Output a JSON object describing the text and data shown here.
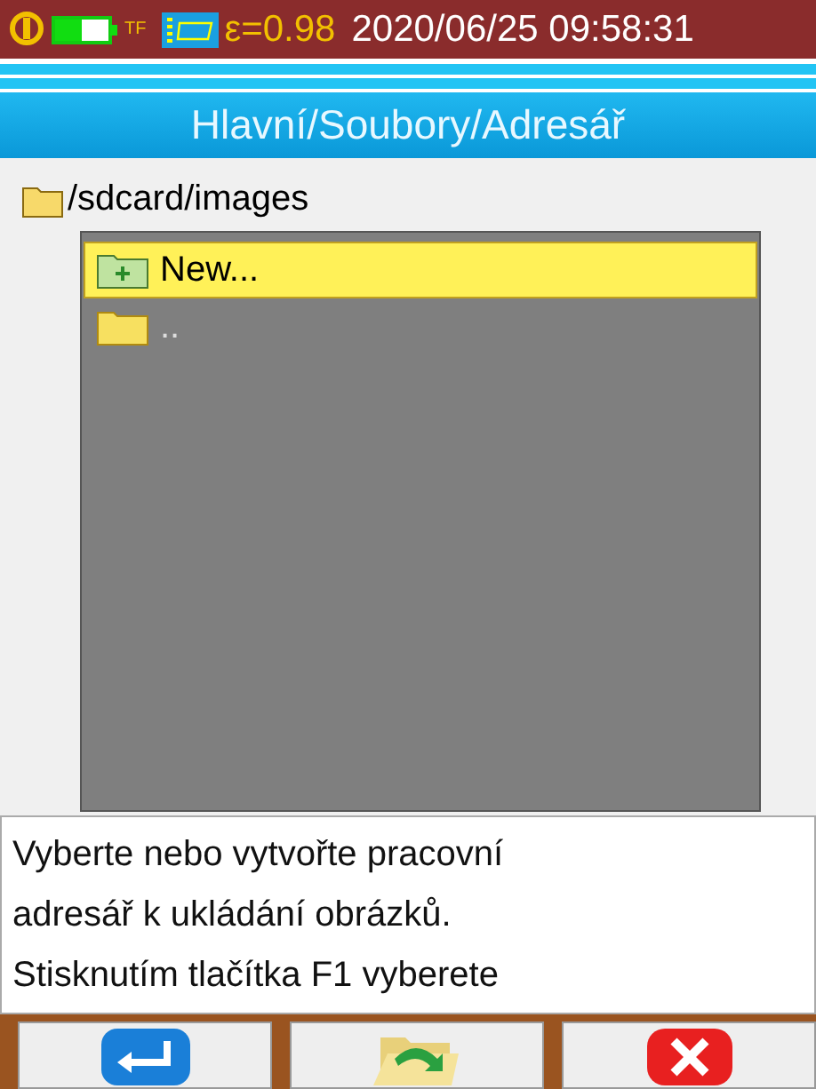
{
  "status_bar": {
    "indicator": "TF",
    "emissivity": "ε=0.98",
    "datetime": "2020/06/25 09:58:31"
  },
  "title": "Hlavní/Soubory/Adresář",
  "path": "/sdcard/images",
  "items": [
    {
      "label": "New...",
      "kind": "new",
      "selected": true
    },
    {
      "label": "..",
      "kind": "folder",
      "selected": false
    }
  ],
  "help_lines": [
    "Vyberte nebo vytvořte pracovní",
    "adresář k ukládání obrázků.",
    "Stisknutím tlačítka F1 vyberete"
  ],
  "buttons": [
    {
      "kind": "enter"
    },
    {
      "kind": "open"
    },
    {
      "kind": "cancel"
    }
  ]
}
